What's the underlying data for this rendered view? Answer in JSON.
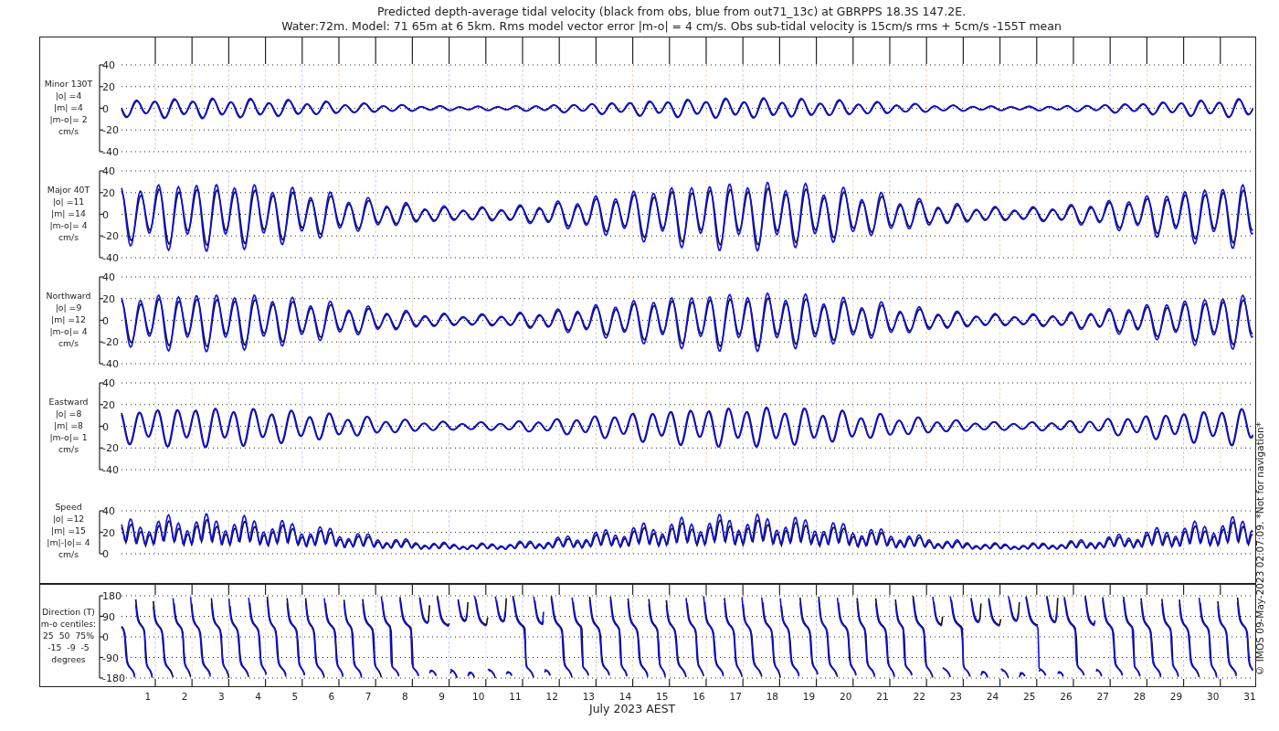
{
  "title": {
    "line_1": "Predicted depth-average tidal velocity (black from obs, blue from out71_13c) at GBRPPS 18.3S 147.2E.",
    "line_2": "Water:72m. Model: 71 65m at 6 5km. Rms model vector error |m-o| = 4 cm/s. Obs sub-tidal velocity is 15cm/s rms + 5cm/s -155T mean"
  },
  "panels": [
    {
      "kind": "minor",
      "label_lines": [
        "Minor 130T",
        "|o| =4",
        "|m| =4",
        "|m-o|= 2",
        "cm/s"
      ],
      "yticks": [
        "40",
        "20",
        "0",
        "-20",
        "-40"
      ]
    },
    {
      "kind": "major",
      "label_lines": [
        "Major 40T",
        "|o| =11",
        "|m| =14",
        "|m-o|= 4",
        "cm/s"
      ],
      "yticks": [
        "40",
        "20",
        "0",
        "-20",
        "-40"
      ]
    },
    {
      "kind": "northward",
      "label_lines": [
        "Northward",
        "|o| =9",
        "|m| =12",
        "|m-o|= 4",
        "cm/s"
      ],
      "yticks": [
        "40",
        "20",
        "0",
        "-20",
        "-40"
      ]
    },
    {
      "kind": "eastward",
      "label_lines": [
        "Eastward",
        "|o| =8",
        "|m| =8",
        "|m-o|= 1",
        "cm/s"
      ],
      "yticks": [
        "40",
        "20",
        "0",
        "-20",
        "-40"
      ]
    },
    {
      "kind": "speed",
      "label_lines": [
        "Speed",
        "|o| =12",
        "|m| =15",
        "|m|-|o|= 4",
        "cm/s"
      ],
      "yticks": [
        "40",
        "20",
        "0"
      ]
    },
    {
      "kind": "direction",
      "label_lines": [
        "Direction (T)",
        "m-o centiles:",
        "25  50  75%",
        "-15  -9  -5",
        "degrees"
      ],
      "yticks": [
        "180",
        "90",
        "0",
        "-90",
        "-180"
      ]
    }
  ],
  "x_axis": {
    "days": [
      "1",
      "2",
      "3",
      "4",
      "5",
      "6",
      "7",
      "8",
      "9",
      "10",
      "11",
      "12",
      "13",
      "14",
      "15",
      "16",
      "17",
      "18",
      "19",
      "20",
      "21",
      "22",
      "23",
      "24",
      "25",
      "26",
      "27",
      "28",
      "29",
      "30",
      "31"
    ],
    "label": "July 2023 AEST"
  },
  "credit": "© IMOS 09-May-2023 02:07:09. *Not for navigation*"
}
